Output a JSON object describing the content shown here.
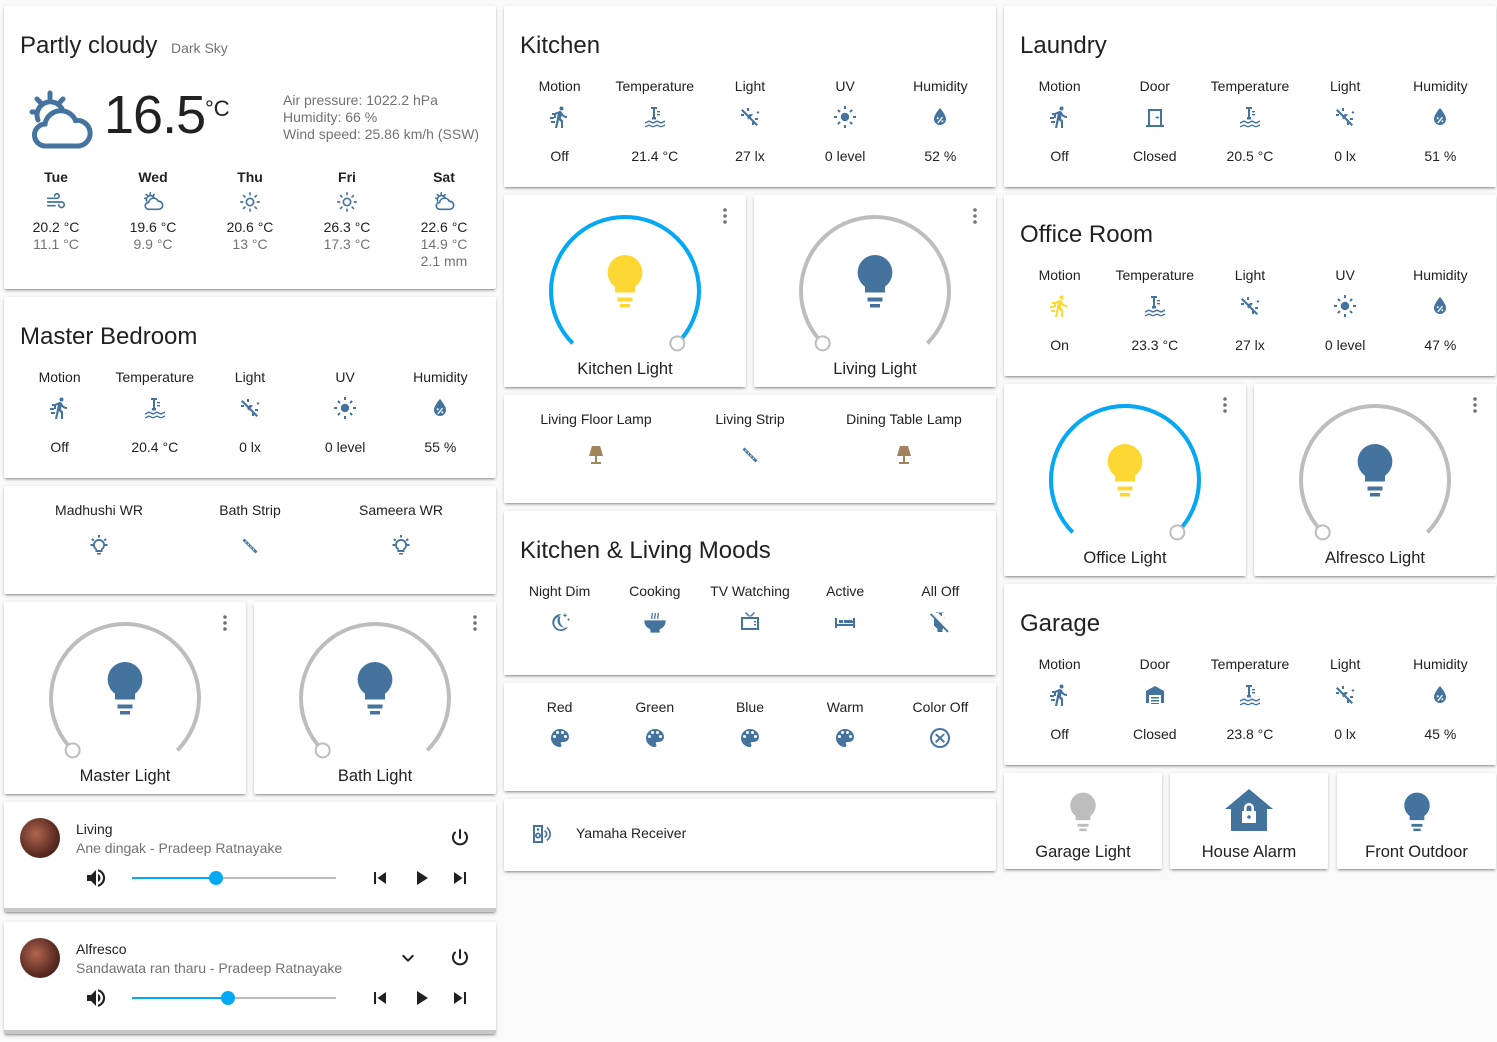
{
  "colors": {
    "primary": "#44739e",
    "active": "#fdd835",
    "accent": "#03a9f4",
    "off_light": "#bdbdbd",
    "lamp": "#a0845c"
  },
  "weather": {
    "condition": "Partly cloudy",
    "source": "Dark Sky",
    "temperature": "16.5",
    "unit": "°C",
    "pressure": "Air pressure: 1022.2 hPa",
    "humidity": "Humidity: 66 %",
    "wind": "Wind speed: 25.86 km/h (SSW)",
    "forecast": [
      {
        "day": "Tue",
        "icon": "windy-icon",
        "high": "20.2 °C",
        "low": "11.1 °C",
        "precip": ""
      },
      {
        "day": "Wed",
        "icon": "partly-cloudy-icon",
        "high": "19.6 °C",
        "low": "9.9 °C",
        "precip": ""
      },
      {
        "day": "Thu",
        "icon": "sunny-icon",
        "high": "20.6 °C",
        "low": "13 °C",
        "precip": ""
      },
      {
        "day": "Fri",
        "icon": "sunny-icon",
        "high": "26.3 °C",
        "low": "17.3 °C",
        "precip": ""
      },
      {
        "day": "Sat",
        "icon": "partly-cloudy-icon",
        "high": "22.6 °C",
        "low": "14.9 °C",
        "precip": "2.1 mm"
      }
    ]
  },
  "master_bedroom": {
    "title": "Master Bedroom",
    "sensors": [
      {
        "label": "Motion",
        "state": "Off"
      },
      {
        "label": "Temperature",
        "state": "20.4 °C"
      },
      {
        "label": "Light",
        "state": "0 lx"
      },
      {
        "label": "UV",
        "state": "0 level"
      },
      {
        "label": "Humidity",
        "state": "55 %"
      }
    ]
  },
  "bedroom_switches": [
    {
      "label": "Madhushi WR"
    },
    {
      "label": "Bath Strip"
    },
    {
      "label": "Sameera WR"
    }
  ],
  "lights": {
    "master": "Master Light",
    "bath": "Bath Light",
    "kitchen": "Kitchen Light",
    "living": "Living Light",
    "office": "Office Light",
    "alfresco": "Alfresco Light"
  },
  "light_levels": {
    "master": 0,
    "bath": 0,
    "kitchen": 1,
    "living": 0,
    "office": 1,
    "alfresco": 0
  },
  "players": [
    {
      "name": "Living",
      "track": "Ane dingak - Pradeep Ratnayake",
      "volume": 0.41
    },
    {
      "name": "Alfresco",
      "track": "Sandawata ran tharu - Pradeep Ratnayake",
      "volume": 0.47
    }
  ],
  "kitchen": {
    "title": "Kitchen",
    "sensors": [
      {
        "label": "Motion",
        "state": "Off"
      },
      {
        "label": "Temperature",
        "state": "21.4 °C"
      },
      {
        "label": "Light",
        "state": "27 lx"
      },
      {
        "label": "UV",
        "state": "0 level"
      },
      {
        "label": "Humidity",
        "state": "52 %"
      }
    ]
  },
  "living_switches": [
    {
      "label": "Living Floor Lamp"
    },
    {
      "label": "Living Strip"
    },
    {
      "label": "Dining Table Lamp"
    }
  ],
  "moods": {
    "title": "Kitchen & Living Moods",
    "scenes": [
      {
        "label": "Night Dim"
      },
      {
        "label": "Cooking"
      },
      {
        "label": "TV Watching"
      },
      {
        "label": "Active"
      },
      {
        "label": "All Off"
      }
    ]
  },
  "colors_scenes": [
    {
      "label": "Red"
    },
    {
      "label": "Green"
    },
    {
      "label": "Blue"
    },
    {
      "label": "Warm"
    },
    {
      "label": "Color Off"
    }
  ],
  "receiver": {
    "label": "Yamaha Receiver"
  },
  "laundry": {
    "title": "Laundry",
    "sensors": [
      {
        "label": "Motion",
        "state": "Off"
      },
      {
        "label": "Door",
        "state": "Closed"
      },
      {
        "label": "Temperature",
        "state": "20.5 °C"
      },
      {
        "label": "Light",
        "state": "0 lx"
      },
      {
        "label": "Humidity",
        "state": "51 %"
      }
    ]
  },
  "office": {
    "title": "Office Room",
    "sensors": [
      {
        "label": "Motion",
        "state": "On"
      },
      {
        "label": "Temperature",
        "state": "23.3 °C"
      },
      {
        "label": "Light",
        "state": "27 lx"
      },
      {
        "label": "UV",
        "state": "0 level"
      },
      {
        "label": "Humidity",
        "state": "47 %"
      }
    ]
  },
  "garage": {
    "title": "Garage",
    "sensors": [
      {
        "label": "Motion",
        "state": "Off"
      },
      {
        "label": "Door",
        "state": "Closed"
      },
      {
        "label": "Temperature",
        "state": "23.8 °C"
      },
      {
        "label": "Light",
        "state": "0 lx"
      },
      {
        "label": "Humidity",
        "state": "45 %"
      }
    ]
  },
  "buttons": [
    {
      "label": "Garage Light"
    },
    {
      "label": "House Alarm"
    },
    {
      "label": "Front Outdoor"
    }
  ]
}
